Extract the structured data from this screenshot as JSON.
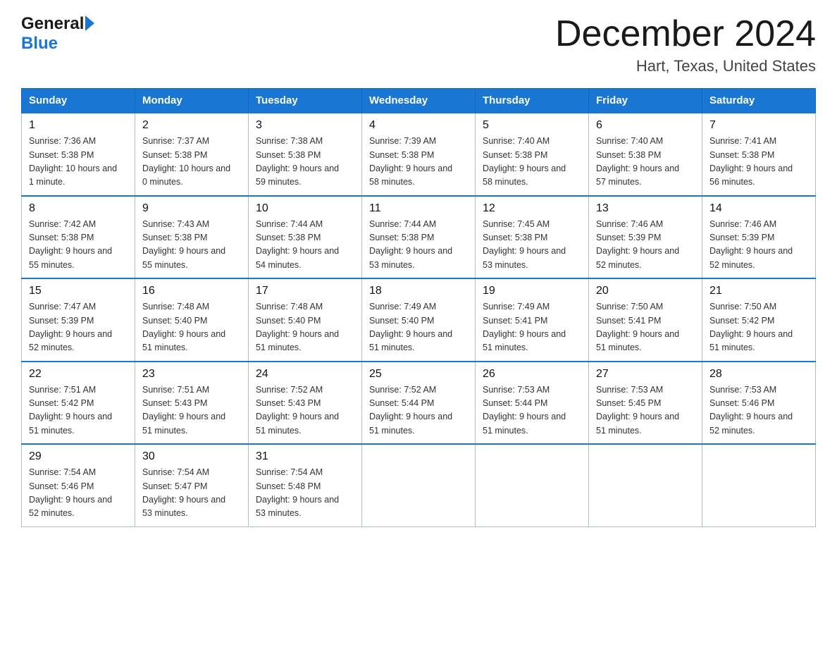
{
  "header": {
    "logo_text_general": "General",
    "logo_text_blue": "Blue",
    "month_title": "December 2024",
    "location": "Hart, Texas, United States"
  },
  "days_of_week": [
    "Sunday",
    "Monday",
    "Tuesday",
    "Wednesday",
    "Thursday",
    "Friday",
    "Saturday"
  ],
  "weeks": [
    [
      {
        "day": "1",
        "sunrise": "7:36 AM",
        "sunset": "5:38 PM",
        "daylight": "10 hours and 1 minute."
      },
      {
        "day": "2",
        "sunrise": "7:37 AM",
        "sunset": "5:38 PM",
        "daylight": "10 hours and 0 minutes."
      },
      {
        "day": "3",
        "sunrise": "7:38 AM",
        "sunset": "5:38 PM",
        "daylight": "9 hours and 59 minutes."
      },
      {
        "day": "4",
        "sunrise": "7:39 AM",
        "sunset": "5:38 PM",
        "daylight": "9 hours and 58 minutes."
      },
      {
        "day": "5",
        "sunrise": "7:40 AM",
        "sunset": "5:38 PM",
        "daylight": "9 hours and 58 minutes."
      },
      {
        "day": "6",
        "sunrise": "7:40 AM",
        "sunset": "5:38 PM",
        "daylight": "9 hours and 57 minutes."
      },
      {
        "day": "7",
        "sunrise": "7:41 AM",
        "sunset": "5:38 PM",
        "daylight": "9 hours and 56 minutes."
      }
    ],
    [
      {
        "day": "8",
        "sunrise": "7:42 AM",
        "sunset": "5:38 PM",
        "daylight": "9 hours and 55 minutes."
      },
      {
        "day": "9",
        "sunrise": "7:43 AM",
        "sunset": "5:38 PM",
        "daylight": "9 hours and 55 minutes."
      },
      {
        "day": "10",
        "sunrise": "7:44 AM",
        "sunset": "5:38 PM",
        "daylight": "9 hours and 54 minutes."
      },
      {
        "day": "11",
        "sunrise": "7:44 AM",
        "sunset": "5:38 PM",
        "daylight": "9 hours and 53 minutes."
      },
      {
        "day": "12",
        "sunrise": "7:45 AM",
        "sunset": "5:38 PM",
        "daylight": "9 hours and 53 minutes."
      },
      {
        "day": "13",
        "sunrise": "7:46 AM",
        "sunset": "5:39 PM",
        "daylight": "9 hours and 52 minutes."
      },
      {
        "day": "14",
        "sunrise": "7:46 AM",
        "sunset": "5:39 PM",
        "daylight": "9 hours and 52 minutes."
      }
    ],
    [
      {
        "day": "15",
        "sunrise": "7:47 AM",
        "sunset": "5:39 PM",
        "daylight": "9 hours and 52 minutes."
      },
      {
        "day": "16",
        "sunrise": "7:48 AM",
        "sunset": "5:40 PM",
        "daylight": "9 hours and 51 minutes."
      },
      {
        "day": "17",
        "sunrise": "7:48 AM",
        "sunset": "5:40 PM",
        "daylight": "9 hours and 51 minutes."
      },
      {
        "day": "18",
        "sunrise": "7:49 AM",
        "sunset": "5:40 PM",
        "daylight": "9 hours and 51 minutes."
      },
      {
        "day": "19",
        "sunrise": "7:49 AM",
        "sunset": "5:41 PM",
        "daylight": "9 hours and 51 minutes."
      },
      {
        "day": "20",
        "sunrise": "7:50 AM",
        "sunset": "5:41 PM",
        "daylight": "9 hours and 51 minutes."
      },
      {
        "day": "21",
        "sunrise": "7:50 AM",
        "sunset": "5:42 PM",
        "daylight": "9 hours and 51 minutes."
      }
    ],
    [
      {
        "day": "22",
        "sunrise": "7:51 AM",
        "sunset": "5:42 PM",
        "daylight": "9 hours and 51 minutes."
      },
      {
        "day": "23",
        "sunrise": "7:51 AM",
        "sunset": "5:43 PM",
        "daylight": "9 hours and 51 minutes."
      },
      {
        "day": "24",
        "sunrise": "7:52 AM",
        "sunset": "5:43 PM",
        "daylight": "9 hours and 51 minutes."
      },
      {
        "day": "25",
        "sunrise": "7:52 AM",
        "sunset": "5:44 PM",
        "daylight": "9 hours and 51 minutes."
      },
      {
        "day": "26",
        "sunrise": "7:53 AM",
        "sunset": "5:44 PM",
        "daylight": "9 hours and 51 minutes."
      },
      {
        "day": "27",
        "sunrise": "7:53 AM",
        "sunset": "5:45 PM",
        "daylight": "9 hours and 51 minutes."
      },
      {
        "day": "28",
        "sunrise": "7:53 AM",
        "sunset": "5:46 PM",
        "daylight": "9 hours and 52 minutes."
      }
    ],
    [
      {
        "day": "29",
        "sunrise": "7:54 AM",
        "sunset": "5:46 PM",
        "daylight": "9 hours and 52 minutes."
      },
      {
        "day": "30",
        "sunrise": "7:54 AM",
        "sunset": "5:47 PM",
        "daylight": "9 hours and 53 minutes."
      },
      {
        "day": "31",
        "sunrise": "7:54 AM",
        "sunset": "5:48 PM",
        "daylight": "9 hours and 53 minutes."
      },
      null,
      null,
      null,
      null
    ]
  ],
  "labels": {
    "sunrise_prefix": "Sunrise: ",
    "sunset_prefix": "Sunset: ",
    "daylight_prefix": "Daylight: "
  }
}
